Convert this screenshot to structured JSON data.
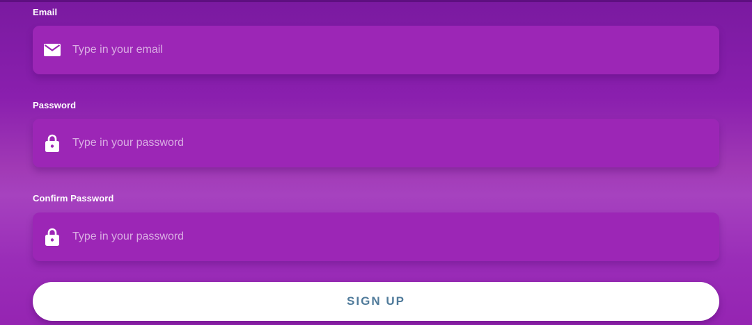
{
  "colors": {
    "background_top": "#7a1aa0",
    "background_mid": "#a642bf",
    "field_background": "#9c26b6",
    "button_background": "#ffffff",
    "button_text": "#4f7a9a"
  },
  "form": {
    "email": {
      "label": "Email",
      "placeholder": "Type in your email",
      "value": "",
      "icon": "mail-icon"
    },
    "password": {
      "label": "Password",
      "placeholder": "Type in your password",
      "value": "",
      "icon": "lock-icon"
    },
    "confirm_password": {
      "label": "Confirm Password",
      "placeholder": "Type in your password",
      "value": "",
      "icon": "lock-icon"
    },
    "submit_label": "SIGN UP"
  }
}
